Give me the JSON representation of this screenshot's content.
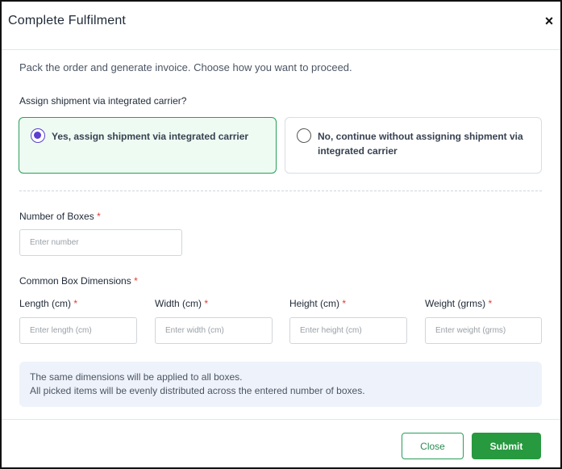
{
  "modal": {
    "title": "Complete Fulfilment",
    "close_symbol": "×",
    "intro": "Pack the order and generate invoice. Choose how you want to proceed."
  },
  "shipment": {
    "question": "Assign shipment via integrated carrier?",
    "options": [
      {
        "label": "Yes, assign shipment via integrated carrier",
        "selected": true
      },
      {
        "label": "No, continue without assigning shipment via integrated carrier",
        "selected": false
      }
    ]
  },
  "boxes": {
    "label": "Number of Boxes",
    "required_mark": "*",
    "placeholder": "Enter number",
    "value": ""
  },
  "dimensions": {
    "label": "Common Box Dimensions",
    "required_mark": "*",
    "fields": [
      {
        "label": "Length (cm)",
        "placeholder": "Enter length (cm)",
        "value": ""
      },
      {
        "label": "Width (cm)",
        "placeholder": "Enter width (cm)",
        "value": ""
      },
      {
        "label": "Height (cm)",
        "placeholder": "Enter height (cm)",
        "value": ""
      },
      {
        "label": "Weight (grms)",
        "placeholder": "Enter weight (grms)",
        "value": ""
      }
    ]
  },
  "info": {
    "line1": "The same dimensions will be applied to all boxes.",
    "line2": "All picked items will be evenly distributed across the entered number of boxes."
  },
  "footer": {
    "close_label": "Close",
    "submit_label": "Submit"
  },
  "colors": {
    "accent_green": "#27993f",
    "radio_purple": "#5b3fd1",
    "required_red": "#e53935",
    "selected_bg": "#eefbf2",
    "info_bg": "#eef2fa"
  }
}
